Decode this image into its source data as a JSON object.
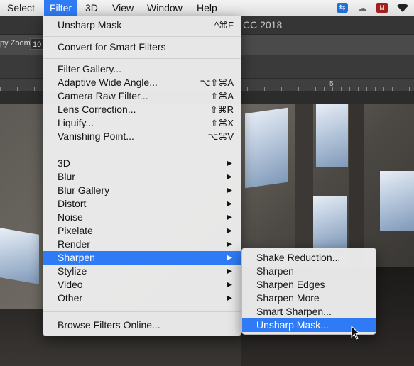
{
  "menubar": {
    "items": [
      {
        "label": "Select"
      },
      {
        "label": "Filter"
      },
      {
        "label": "3D"
      },
      {
        "label": "View"
      },
      {
        "label": "Window"
      },
      {
        "label": "Help"
      }
    ],
    "tray_icons": [
      "teamviewer-icon",
      "creative-cloud-icon",
      "antivirus-shield-icon",
      "wifi-icon"
    ]
  },
  "app": {
    "title_fragment": "CC 2018",
    "options_label": "py Zoom",
    "zoom_value": "10",
    "ruler_label": "5"
  },
  "filter_menu": {
    "top": [
      {
        "label": "Unsharp Mask",
        "shortcut": "^⌘F"
      },
      {
        "label": "Convert for Smart Filters",
        "shortcut": ""
      }
    ],
    "group2": [
      {
        "label": "Filter Gallery...",
        "shortcut": ""
      },
      {
        "label": "Adaptive Wide Angle...",
        "shortcut": "⌥⇧⌘A"
      },
      {
        "label": "Camera Raw Filter...",
        "shortcut": "⇧⌘A"
      },
      {
        "label": "Lens Correction...",
        "shortcut": "⇧⌘R"
      },
      {
        "label": "Liquify...",
        "shortcut": "⇧⌘X"
      },
      {
        "label": "Vanishing Point...",
        "shortcut": "⌥⌘V"
      }
    ],
    "submenus": [
      "3D",
      "Blur",
      "Blur Gallery",
      "Distort",
      "Noise",
      "Pixelate",
      "Render",
      "Sharpen",
      "Stylize",
      "Video",
      "Other"
    ],
    "active_submenu": "Sharpen",
    "bottom": [
      {
        "label": "Browse Filters Online..."
      }
    ]
  },
  "sharpen_menu": {
    "items": [
      "Shake Reduction...",
      "Sharpen",
      "Sharpen Edges",
      "Sharpen More",
      "Smart Sharpen...",
      "Unsharp Mask..."
    ],
    "active": "Unsharp Mask..."
  },
  "colors": {
    "accent": "#2f7bf5"
  }
}
